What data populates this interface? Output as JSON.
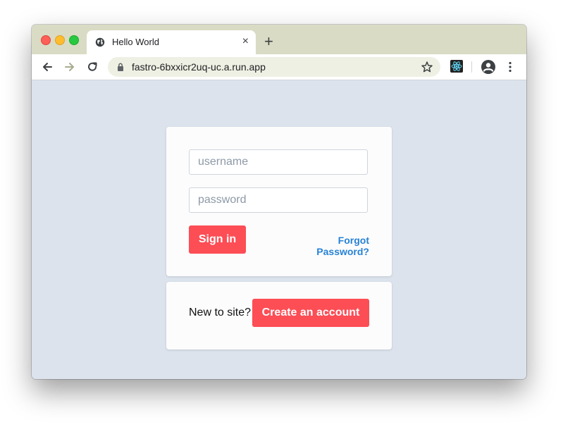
{
  "browser": {
    "tab_title": "Hello World",
    "tab_close": "×",
    "new_tab": "+",
    "url": "fastro-6bxxicr2uq-uc.a.run.app"
  },
  "login": {
    "username_placeholder": "username",
    "password_placeholder": "password",
    "signin_label": "Sign in",
    "forgot_label": "Forgot Password?"
  },
  "signup": {
    "prompt": "New to site?",
    "create_label": "Create an account"
  },
  "colors": {
    "accent_button": "#fd4d55",
    "link": "#2782d6",
    "background": "#dce3ed",
    "tabstrip": "#d9dbc4"
  }
}
